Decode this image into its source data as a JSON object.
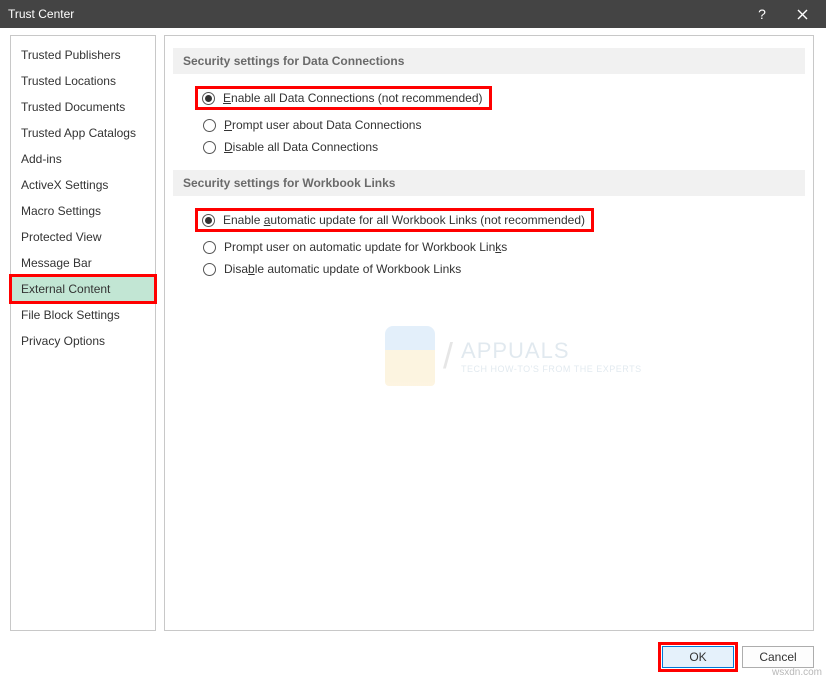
{
  "window": {
    "title": "Trust Center"
  },
  "sidebar": {
    "items": [
      {
        "label": "Trusted Publishers",
        "selected": false
      },
      {
        "label": "Trusted Locations",
        "selected": false
      },
      {
        "label": "Trusted Documents",
        "selected": false
      },
      {
        "label": "Trusted App Catalogs",
        "selected": false
      },
      {
        "label": "Add-ins",
        "selected": false
      },
      {
        "label": "ActiveX Settings",
        "selected": false
      },
      {
        "label": "Macro Settings",
        "selected": false
      },
      {
        "label": "Protected View",
        "selected": false
      },
      {
        "label": "Message Bar",
        "selected": false
      },
      {
        "label": "External Content",
        "selected": true
      },
      {
        "label": "File Block Settings",
        "selected": false
      },
      {
        "label": "Privacy Options",
        "selected": false
      }
    ]
  },
  "sections": {
    "data_connections": {
      "header": "Security settings for Data Connections",
      "options": [
        {
          "label_pre": "",
          "u": "E",
          "label_post": "nable all Data Connections (not recommended)",
          "checked": true,
          "highlighted": true
        },
        {
          "label_pre": "",
          "u": "P",
          "label_post": "rompt user about Data Connections",
          "checked": false,
          "highlighted": false
        },
        {
          "label_pre": "",
          "u": "D",
          "label_post": "isable all Data Connections",
          "checked": false,
          "highlighted": false
        }
      ]
    },
    "workbook_links": {
      "header": "Security settings for Workbook Links",
      "options": [
        {
          "label_pre": "Enable ",
          "u": "a",
          "label_post": "utomatic update for all Workbook Links (not recommended)",
          "checked": true,
          "highlighted": true
        },
        {
          "label_pre": "Prompt user on automatic update for Workbook Lin",
          "u": "k",
          "label_post": "s",
          "checked": false,
          "highlighted": false
        },
        {
          "label_pre": "Disa",
          "u": "b",
          "label_post": "le automatic update of Workbook Links",
          "checked": false,
          "highlighted": false
        }
      ]
    }
  },
  "watermark": {
    "brand": "APPUALS",
    "tagline": "TECH HOW-TO'S FROM THE EXPERTS"
  },
  "buttons": {
    "ok": "OK",
    "cancel": "Cancel"
  },
  "credit": "wsxdn.com"
}
